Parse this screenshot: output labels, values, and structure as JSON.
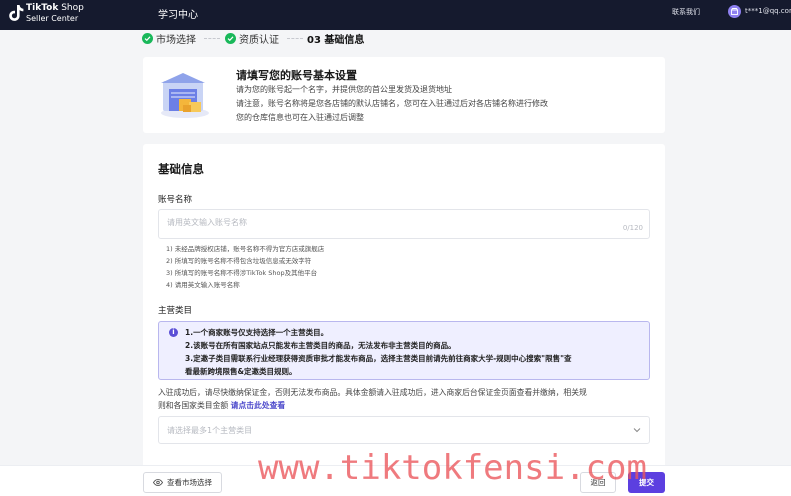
{
  "header": {
    "logo_line1_bold": "TikTok",
    "logo_line1_light": " Shop",
    "logo_line2": "Seller Center",
    "nav_learning": "学习中心",
    "contact": "联系我们",
    "email": "t***1@qq.com"
  },
  "steps": [
    {
      "label": "市场选择",
      "status": "done"
    },
    {
      "label": "资质认证",
      "status": "done"
    },
    {
      "label": "03 基础信息",
      "status": "current"
    }
  ],
  "intro": {
    "title": "请填写您的账号基本设置",
    "lines": [
      "请为您的账号起一个名字，并提供您的首公里发货及退货地址",
      "请注意，账号名称将是您各店铺的默认店铺名，您可在入驻通过后对各店铺名称进行修改",
      "您的仓库信息也可在入驻通过后调整"
    ]
  },
  "form": {
    "section_title": "基础信息",
    "account_name_label": "账号名称",
    "account_name_placeholder": "请用英文输入账号名称",
    "account_name_value": "",
    "counter": "0/120",
    "rules": [
      "1) 未经品牌授权店铺，账号名称不得为官方店或旗舰店",
      "2) 所填写的账号名称不得包含垃圾信息或无效字符",
      "3) 所填写的账号名称不得涉TikTok Shop及其他平台",
      "4) 请用英文输入账号名称"
    ],
    "category_label": "主营类目",
    "notice": [
      "1.一个商家账号仅支持选择一个主营类目。",
      "2.该账号在所有国家站点只能发布主营类目的商品，无法发布非主营类目的商品。",
      "3.定邀子类目需联系行业经理获得资质审批才能发布商品，选择主营类目前请先前往商家大学-规则中心搜索\"限售\"查",
      "看最新跨境限售&定邀类目规则。"
    ],
    "deposit_line1": "入驻成功后，请尽快缴纳保证金，否则无法发布商品。具体金额请入驻成功后，进入商家后台保证金页面查看并缴纳，相关规",
    "deposit_line2": "则和各国家类目金额 ",
    "deposit_link": "请点击此处查看",
    "category_placeholder": "请选择最多1个主营类目"
  },
  "footer": {
    "view_market": "查看市场选择",
    "back": "返回",
    "submit": "提交"
  },
  "watermark": "www.tiktokfensi.com",
  "colors": {
    "topbar": "#151a2e",
    "accent": "#5c3fe0",
    "success": "#19b85a",
    "notice_bg": "#efefff",
    "watermark": "#eb555a"
  }
}
